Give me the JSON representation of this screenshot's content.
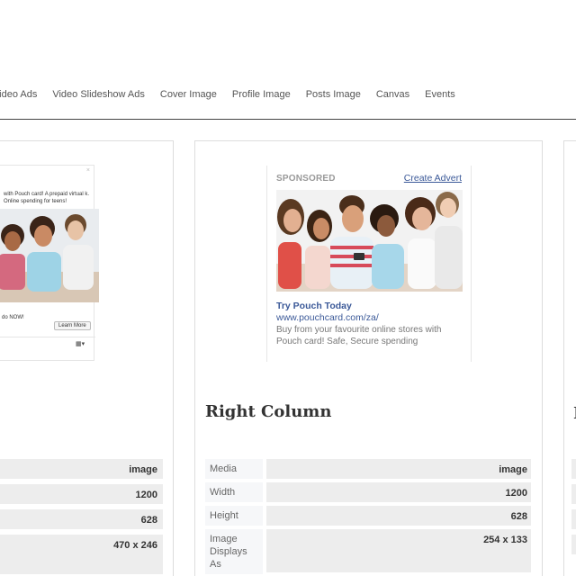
{
  "nav": {
    "items": [
      "Video Ads",
      "Video Slideshow Ads",
      "Cover Image",
      "Profile Image",
      "Posts Image",
      "Canvas",
      "Events"
    ]
  },
  "left_card": {
    "ad": {
      "close": "×",
      "text": "with Pouch card! A prepaid virtual k. Online spending for teens!",
      "cta_text": "do NOW!",
      "learn_more": "Learn More"
    },
    "values": [
      "image",
      "1200",
      "628",
      "470 x 246"
    ]
  },
  "middle_card": {
    "ad": {
      "sponsored": "SPONSORED",
      "create_advert": "Create Advert",
      "title": "Try Pouch Today",
      "url": "www.pouchcard.com/za/",
      "description": "Buy from your favourite online stores with Pouch card! Safe, Secure spending"
    },
    "section_title": "Right Column",
    "specs": [
      {
        "label": "Media",
        "value": "image"
      },
      {
        "label": "Width",
        "value": "1200"
      },
      {
        "label": "Height",
        "value": "628"
      },
      {
        "label": "Image Displays As",
        "value": "254 x 133"
      }
    ]
  },
  "right_card": {
    "section_title_fragment": "I"
  },
  "colors": {
    "link": "#3b5998",
    "value_bg": "#ededed",
    "label_bg": "#f6f7f9",
    "rule": "#444444"
  }
}
